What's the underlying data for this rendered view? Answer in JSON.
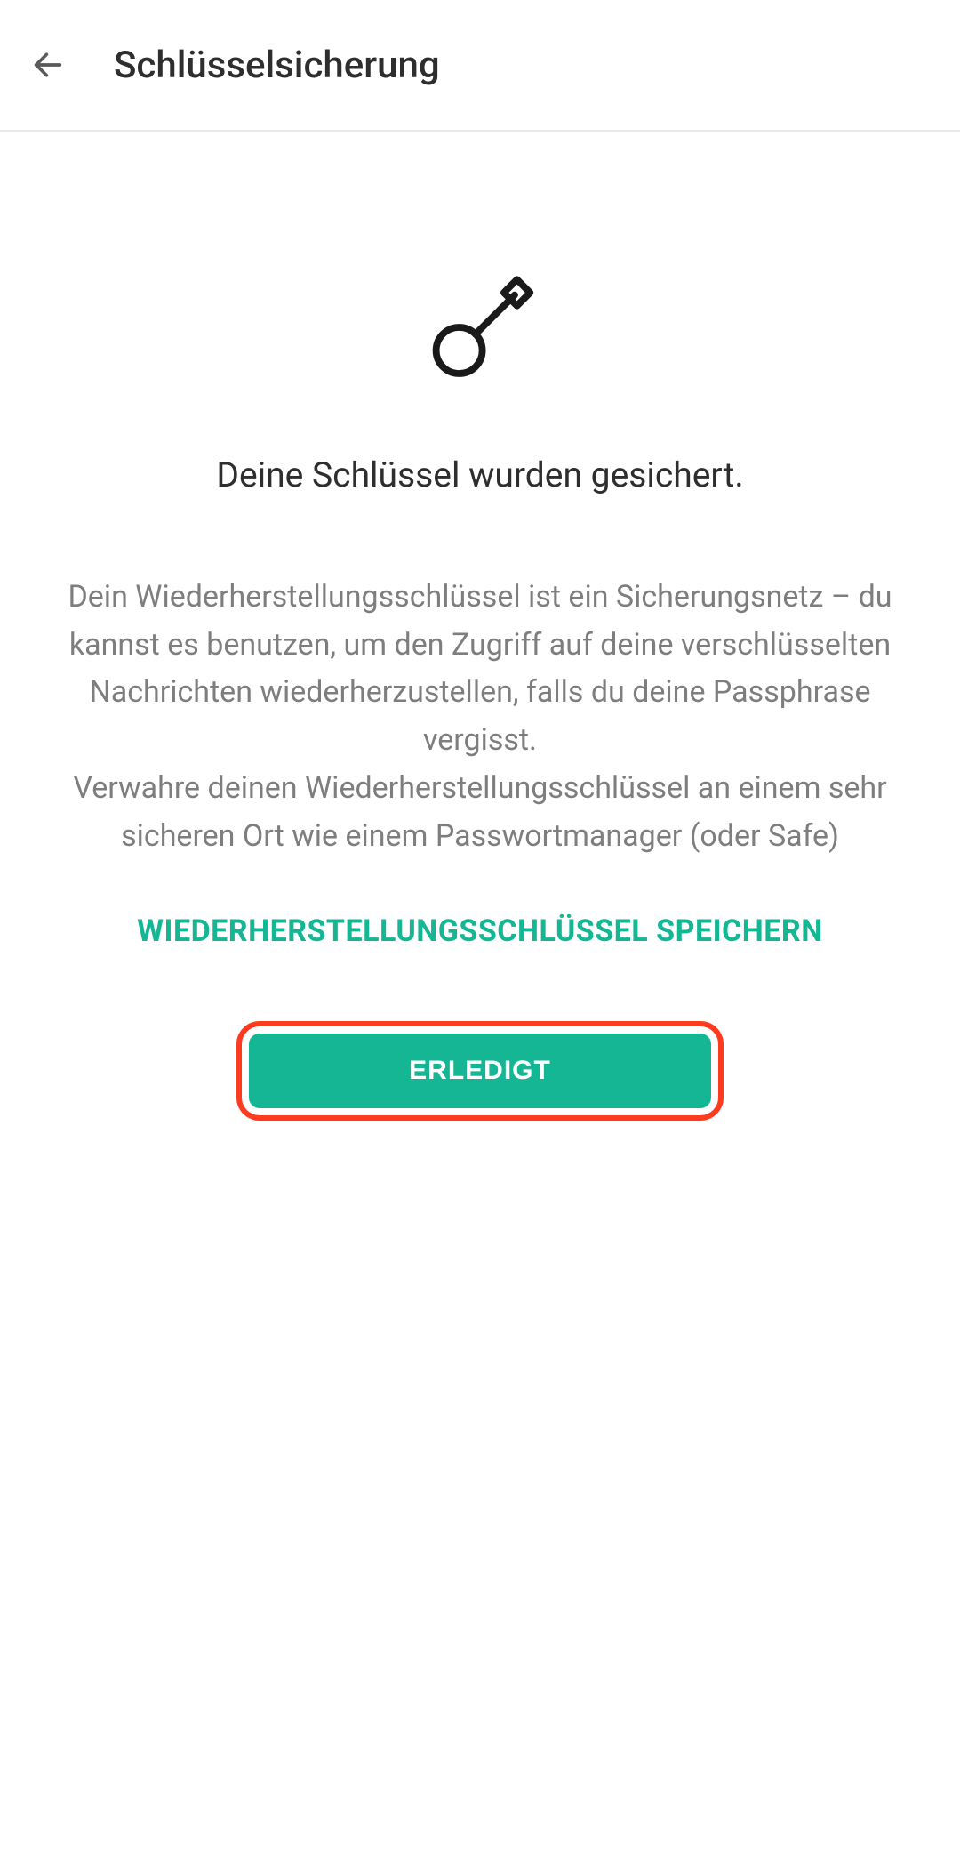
{
  "header": {
    "title": "Schlüsselsicherung"
  },
  "content": {
    "success_message": "Deine Schlüssel wurden gesichert.",
    "description_line1": "Dein Wiederherstellungsschlüssel ist ein Sicherungsnetz – du kannst es benutzen, um den Zugriff auf deine verschlüsselten Nachrichten wiederherzustellen, falls du deine Passphrase vergisst.",
    "description_line2": "Verwahre deinen Wiederherstellungsschlüssel an einem sehr sicheren Ort wie einem Passwortmanager (oder Safe)",
    "save_link": "WIEDERHERSTELLUNGSSCHLÜSSEL SPEICHERN",
    "done_button": "ERLEDIGT"
  },
  "colors": {
    "accent": "#14b693",
    "highlight": "#ff3b1f",
    "text_primary": "#2e2e2e",
    "text_secondary": "#7e7e7e"
  }
}
